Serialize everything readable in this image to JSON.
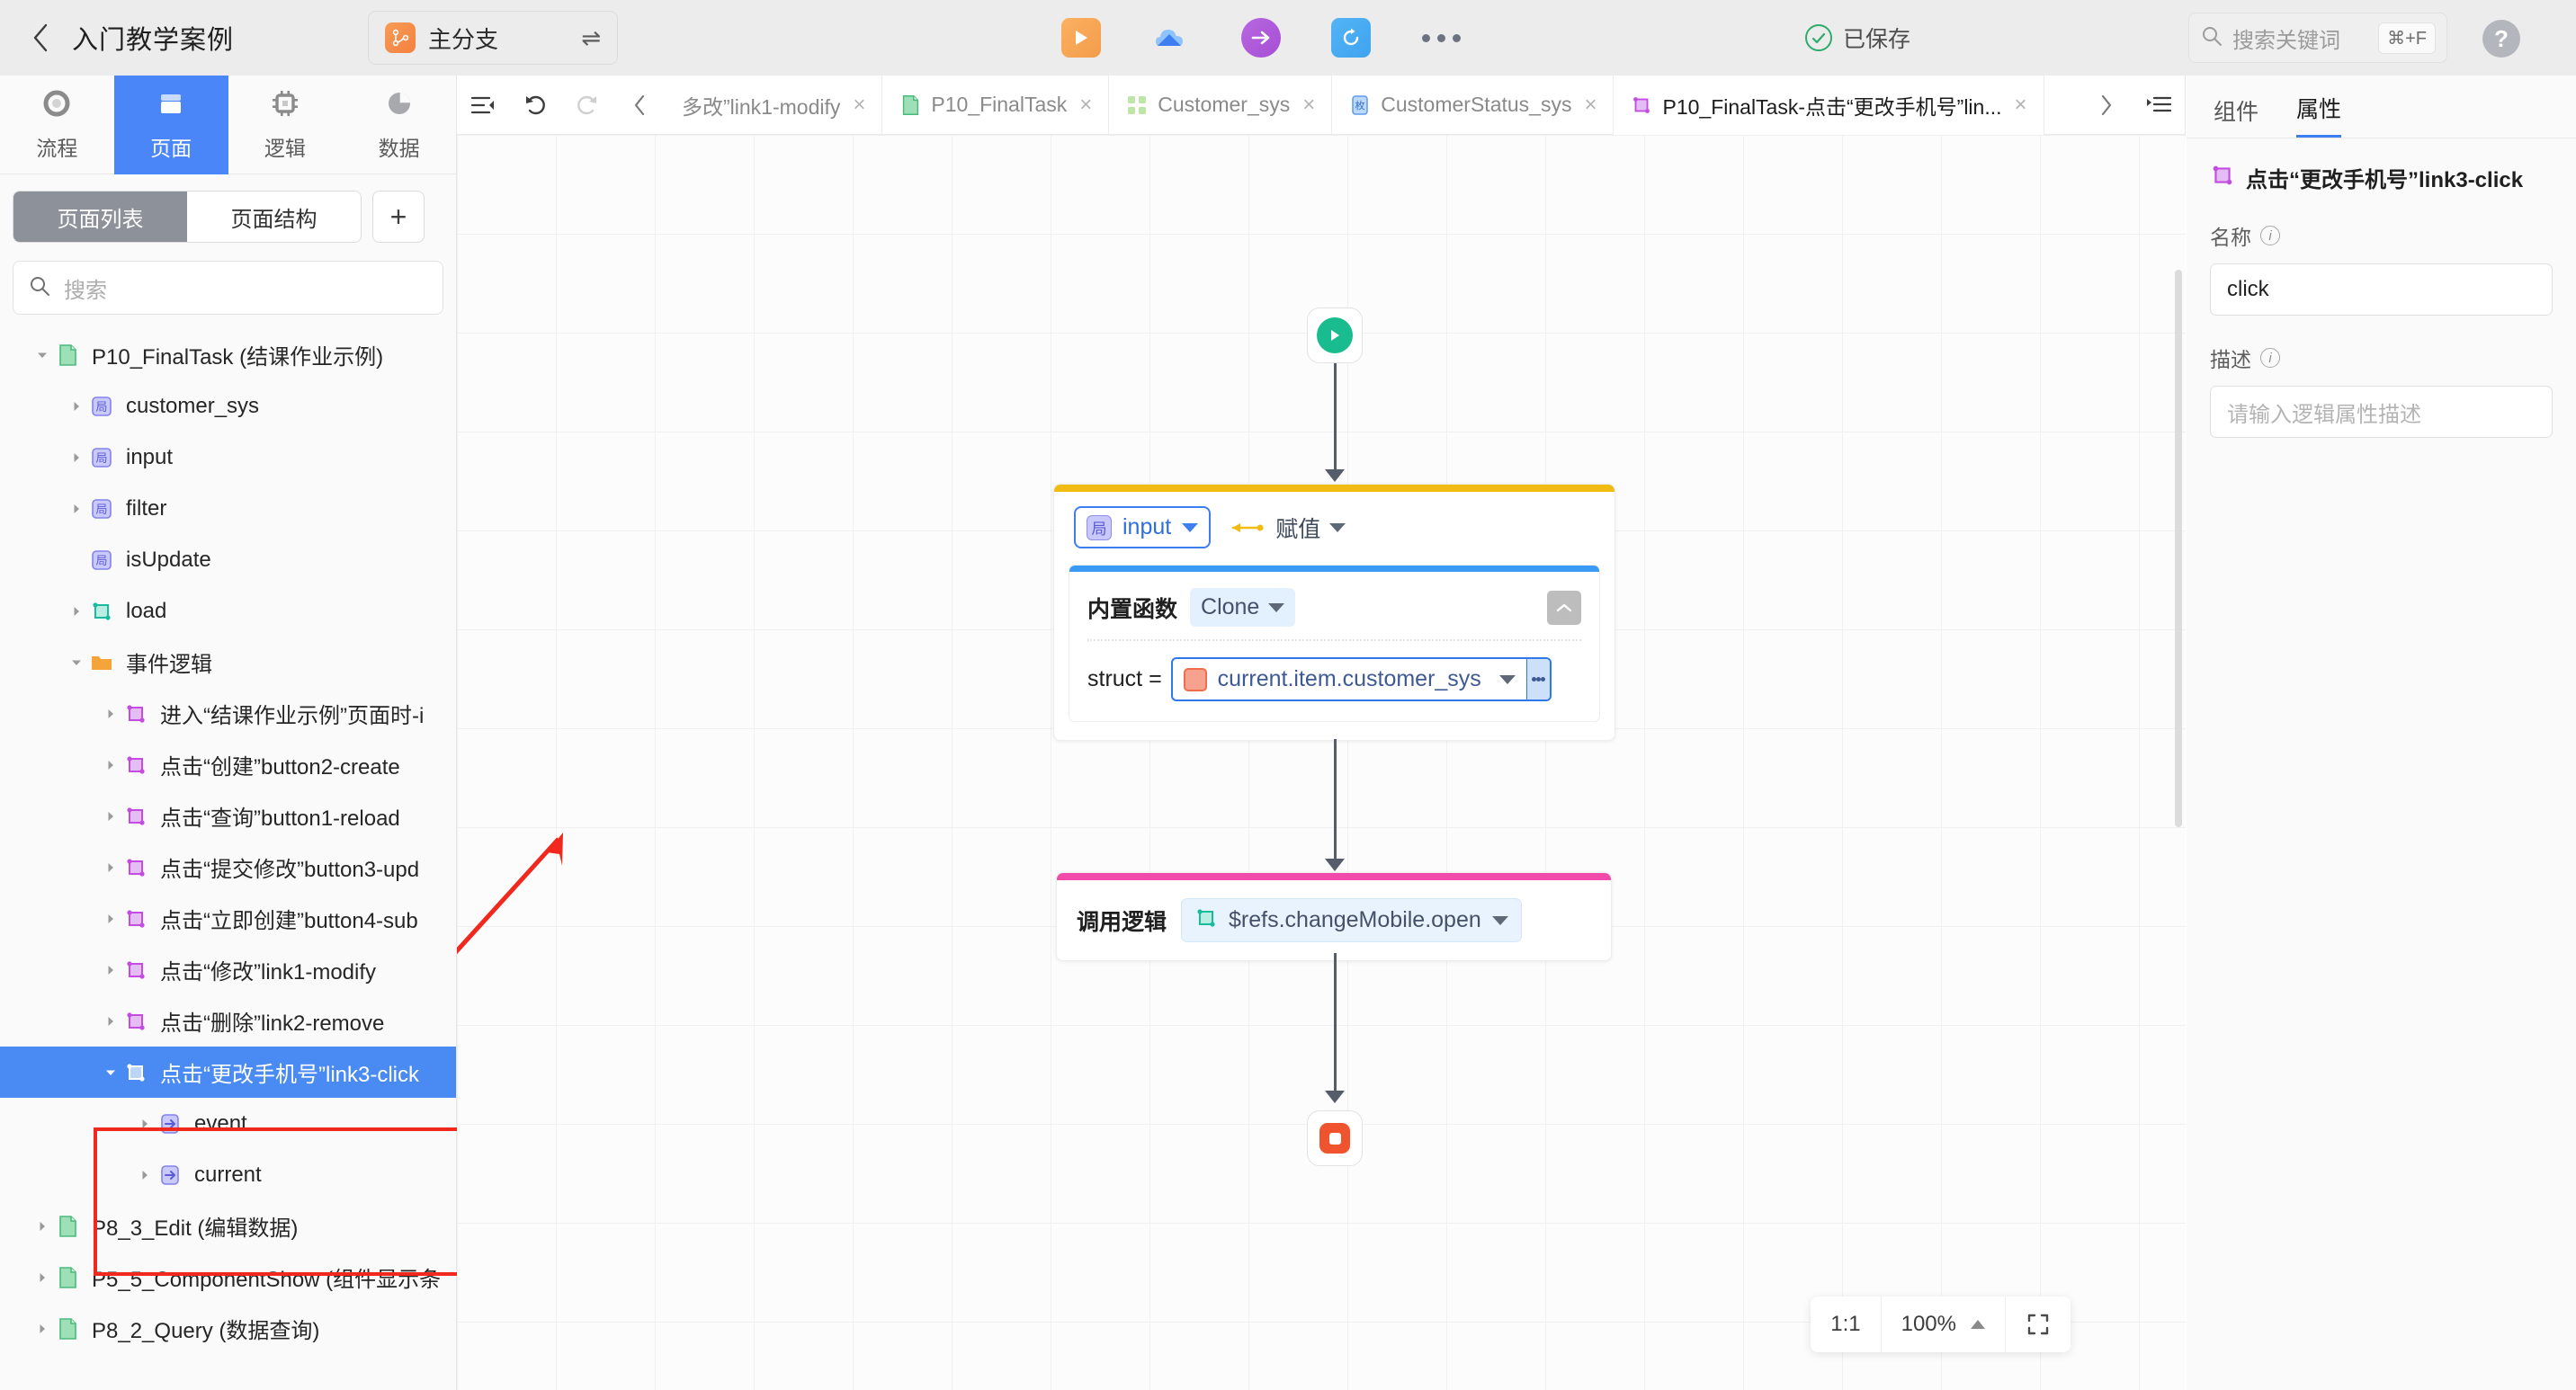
{
  "topbar": {
    "project_title": "入门教学案例",
    "branch_label": "主分支",
    "branch_icon": "branch-icon",
    "swap_icon": "⇌",
    "actions": [
      {
        "name": "run-preview-icon",
        "glyph": "▶"
      },
      {
        "name": "cloud-publish-icon",
        "glyph": "☁"
      },
      {
        "name": "deploy-arrow-icon",
        "glyph": "→"
      },
      {
        "name": "sync-refresh-icon",
        "glyph": "↻"
      },
      {
        "name": "more-options-icon",
        "glyph": "•••"
      }
    ],
    "saved_text": "已保存",
    "search_placeholder": "搜索关键词",
    "search_shortcut": "⌘+F",
    "help_label": "?"
  },
  "left": {
    "modes": [
      {
        "label": "流程",
        "icon": "flow-icon",
        "active": false
      },
      {
        "label": "页面",
        "icon": "page-icon",
        "active": true
      },
      {
        "label": "逻辑",
        "icon": "logic-icon",
        "active": false
      },
      {
        "label": "数据",
        "icon": "data-icon",
        "active": false
      }
    ],
    "segments": [
      {
        "label": "页面列表",
        "active": true
      },
      {
        "label": "页面结构",
        "active": false
      }
    ],
    "add_label": "+",
    "search_placeholder": "搜索",
    "tree": [
      {
        "label": "P10_FinalTask (结课作业示例)",
        "indent": 0,
        "icon": "page-file-icon",
        "caret": "down",
        "selected": false
      },
      {
        "label": "customer_sys",
        "indent": 1,
        "icon": "local-var-icon",
        "caret": "right",
        "selected": false
      },
      {
        "label": "input",
        "indent": 1,
        "icon": "local-var-icon",
        "caret": "right",
        "selected": false
      },
      {
        "label": "filter",
        "indent": 1,
        "icon": "local-var-icon",
        "caret": "right",
        "selected": false
      },
      {
        "label": "isUpdate",
        "indent": 1,
        "icon": "local-var-icon",
        "caret": "none",
        "selected": false
      },
      {
        "label": "load",
        "indent": 1,
        "icon": "logic-teal-icon",
        "caret": "right",
        "selected": false
      },
      {
        "label": "事件逻辑",
        "indent": 1,
        "icon": "folder-icon",
        "caret": "down",
        "selected": false
      },
      {
        "label": "进入“结课作业示例”页面时-i",
        "indent": 2,
        "icon": "logic-purple-icon",
        "caret": "right",
        "selected": false
      },
      {
        "label": "点击“创建”button2-create",
        "indent": 2,
        "icon": "logic-purple-icon",
        "caret": "right",
        "selected": false
      },
      {
        "label": "点击“查询”button1-reload",
        "indent": 2,
        "icon": "logic-purple-icon",
        "caret": "right",
        "selected": false
      },
      {
        "label": "点击“提交修改”button3-upd",
        "indent": 2,
        "icon": "logic-purple-icon",
        "caret": "right",
        "selected": false
      },
      {
        "label": "点击“立即创建”button4-sub",
        "indent": 2,
        "icon": "logic-purple-icon",
        "caret": "right",
        "selected": false
      },
      {
        "label": "点击“修改”link1-modify",
        "indent": 2,
        "icon": "logic-purple-icon",
        "caret": "right",
        "selected": false
      },
      {
        "label": "点击“删除”link2-remove",
        "indent": 2,
        "icon": "logic-purple-icon",
        "caret": "right",
        "selected": false
      },
      {
        "label": "点击“更改手机号”link3-click",
        "indent": 2,
        "icon": "logic-purple-icon",
        "caret": "down",
        "selected": true
      },
      {
        "label": "event",
        "indent": 3,
        "icon": "param-in-icon",
        "caret": "right",
        "selected": false
      },
      {
        "label": "current",
        "indent": 3,
        "icon": "param-in-icon",
        "caret": "right",
        "selected": false
      },
      {
        "label": "P8_3_Edit (编辑数据)",
        "indent": 0,
        "icon": "page-file-icon",
        "caret": "right",
        "selected": false
      },
      {
        "label": "P5_5_ComponentShow (组件显示条",
        "indent": 0,
        "icon": "page-file-icon",
        "caret": "right",
        "selected": false
      },
      {
        "label": "P8_2_Query (数据查询)",
        "indent": 0,
        "icon": "page-file-icon",
        "caret": "right",
        "selected": false
      }
    ]
  },
  "editor": {
    "toolbar": {
      "panel_toggle_icon": "collapse-panel-icon",
      "undo_icon": "undo-icon",
      "redo_icon": "redo-icon",
      "prev_tab_icon": "chevron-left-icon",
      "next_tab_icon": "chevron-right-icon",
      "tab_list_icon": "tab-list-icon"
    },
    "tabs": [
      {
        "label": "多改”link1-modify",
        "icon": "none",
        "active": false
      },
      {
        "label": "P10_FinalTask",
        "icon": "page-file-icon",
        "active": false
      },
      {
        "label": "Customer_sys",
        "icon": "component-grid-icon",
        "active": false
      },
      {
        "label": "CustomerStatus_sys",
        "icon": "enum-icon",
        "active": false
      },
      {
        "label": "P10_FinalTask-点击“更改手机号”lin...",
        "icon": "logic-purple-icon",
        "active": true
      }
    ],
    "close_glyph": "×",
    "flow": {
      "start_node": "start-node",
      "end_node": "end-node",
      "assign_node": {
        "variable": "input",
        "variable_icon": "local-var-icon",
        "operator_label": "赋值",
        "fn_label": "内置函数",
        "fn_value": "Clone",
        "struct_label": "struct =",
        "struct_value": "current.item.customer_sys",
        "struct_icon": "struct-type-icon",
        "collapse_icon": "chevron-up-icon"
      },
      "call_node": {
        "label": "调用逻辑",
        "value": "$refs.changeMobile.open",
        "icon": "logic-teal-icon"
      }
    },
    "zoom": {
      "fit_label": "1:1",
      "level": "100%",
      "expand_icon": "fit-screen-icon",
      "caret_icon": "caret-up-icon"
    }
  },
  "right": {
    "tabs": [
      {
        "label": "组件",
        "active": false
      },
      {
        "label": "属性",
        "active": true
      }
    ],
    "header": {
      "title": "点击“更改手机号”link3-click",
      "icon": "logic-purple-icon"
    },
    "fields": [
      {
        "label": "名称",
        "value": "click",
        "placeholder": "",
        "is_placeholder": false
      },
      {
        "label": "描述",
        "value": "请输入逻辑属性描述",
        "placeholder": "请输入逻辑属性描述",
        "is_placeholder": true
      }
    ]
  },
  "colors": {
    "accent_blue": "#4a86f7",
    "selection_blue": "#4a8af3",
    "annotation_red": "#f0281e",
    "assign_node_top": "#f2bb12",
    "call_node_top": "#f24aa8",
    "inner_card_top": "#3a9af5",
    "start_green": "#18bc8e",
    "end_red": "#f0542e"
  }
}
